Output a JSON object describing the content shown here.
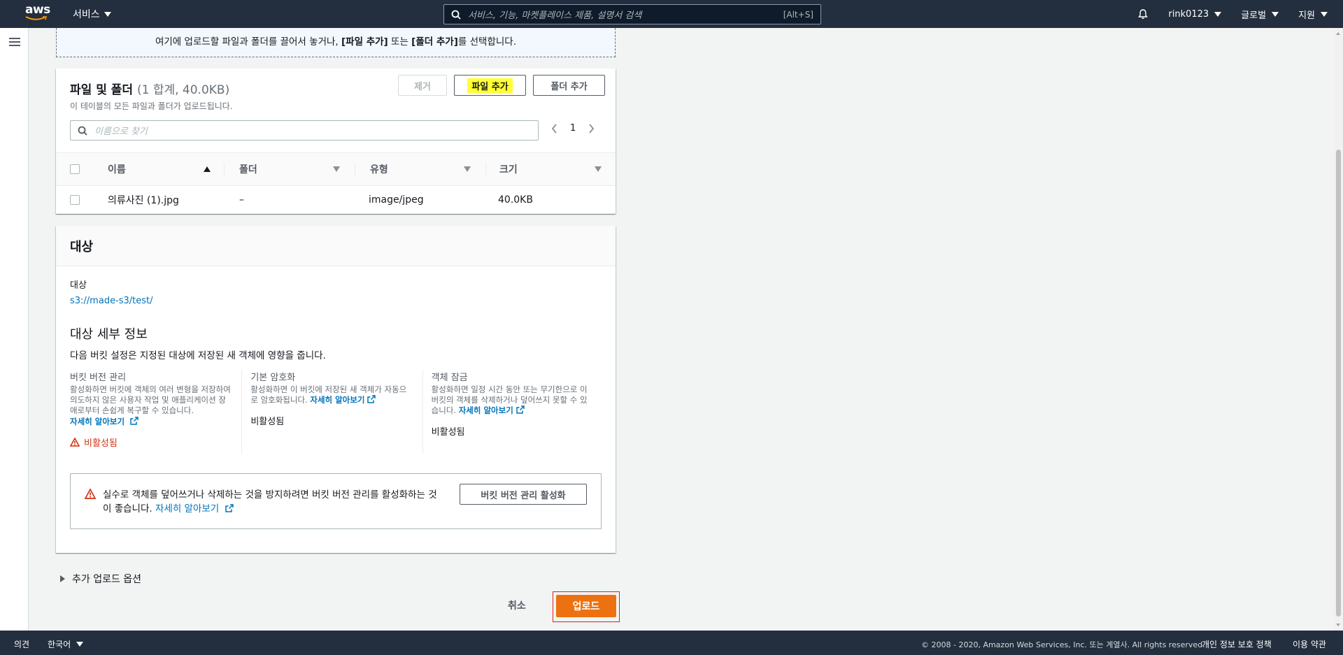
{
  "nav": {
    "logo_text": "aws",
    "services_label": "서비스",
    "search_placeholder": "서비스, 기능, 마켓플레이스 제품, 설명서 검색",
    "search_hint": "[Alt+S]",
    "account": "rink0123",
    "region": "글로벌",
    "support": "지원"
  },
  "dropzone": {
    "text_before": "여기에 업로드할 파일과 폴더를 끌어서 놓거나, ",
    "bold1": "[파일 추가]",
    "mid": " 또는 ",
    "bold2": "[폴더 추가]",
    "text_after": "를 선택합니다."
  },
  "files": {
    "title": "파일 및 폴더",
    "count": "(1 합계, 40.0KB)",
    "description": "이 테이블의 모든 파일과 폴더가 업로드됩니다.",
    "remove_label": "제거",
    "add_files_label": "파일 추가",
    "add_folder_label": "폴더 추가",
    "search_placeholder": "이름으로 찾기",
    "page": "1",
    "columns": [
      "이름",
      "폴더",
      "유형",
      "크기"
    ],
    "rows": [
      {
        "name": "의류사진 (1).jpg",
        "folder": "–",
        "type": "image/jpeg",
        "size": "40.0KB"
      }
    ]
  },
  "destination": {
    "title": "대상",
    "label": "대상",
    "path": "s3://made-s3/test/",
    "details_title": "대상 세부 정보",
    "details_desc": "다음 버킷 설정은 지정된 대상에 저장된 새 객체에 영향을 줍니다.",
    "learn_more": "자세히 알아보기",
    "versioning": {
      "heading": "버킷 버전 관리",
      "desc": "활성화하면 버킷에 객체의 여러 변형을 저장하여 의도하지 않은 사용자 작업 및 애플리케이션 장애로부터 손쉽게 복구할 수 있습니다.",
      "status": "비활성됨"
    },
    "encryption": {
      "heading": "기본 암호화",
      "desc": "활성화하면 이 버킷에 저장된 새 객체가 자동으로 암호화됩니다.",
      "status": "비활성됨"
    },
    "lock": {
      "heading": "객체 잠금",
      "desc": "활성화하면 일정 시간 동안 또는 무기한으로 이 버킷의 객체를 삭제하거나 덮어쓰지 못할 수 있습니다.",
      "status": "비활성됨"
    },
    "alert": {
      "message": "실수로 객체를 덮어쓰거나 삭제하는 것을 방지하려면 버킷 버전 관리를 활성화하는 것이 좋습니다.",
      "link": "자세히 알아보기",
      "button": "버킷 버전 관리 활성화"
    }
  },
  "actions": {
    "more_options": "추가 업로드 옵션",
    "cancel": "취소",
    "upload": "업로드"
  },
  "footer": {
    "feedback": "의견",
    "language": "한국어",
    "copyright": "© 2008 - 2020, Amazon Web Services, Inc. 또는 계열사. All rights reserved.",
    "privacy": "개인 정보 보호 정책",
    "terms": "이용 약관"
  },
  "colors": {
    "nav_bg": "#232f3e",
    "primary": "#ec7211",
    "link": "#0073bb",
    "danger": "#d13212",
    "highlight": "#ffff33"
  }
}
